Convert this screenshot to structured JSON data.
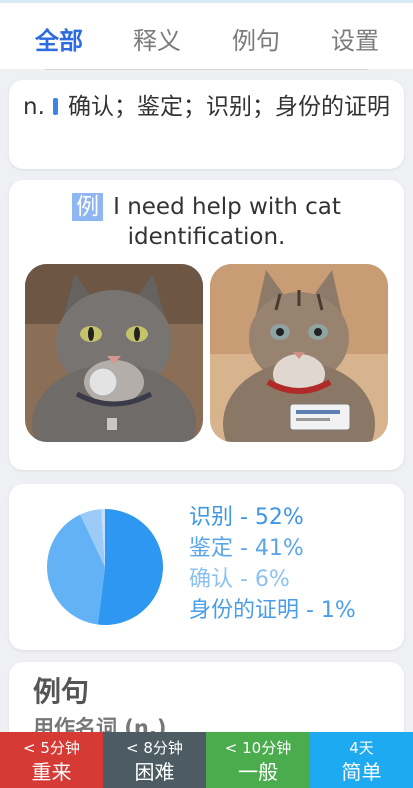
{
  "tabs": [
    {
      "label": "全部",
      "active": true
    },
    {
      "label": "释义",
      "active": false
    },
    {
      "label": "例句",
      "active": false
    },
    {
      "label": "设置",
      "active": false
    }
  ],
  "definition": {
    "pos": "n.",
    "text": "确认；鉴定；识别；身份的证明"
  },
  "example": {
    "badge": "例",
    "sentence": "I need help with cat identification."
  },
  "meaning_stats": {
    "chart_data": {
      "type": "pie",
      "categories": [
        "识别",
        "鉴定",
        "确认",
        "身份的证明"
      ],
      "values": [
        52,
        41,
        6,
        1
      ],
      "colors": [
        "#2e97f2",
        "#64b2f6",
        "#9ccbf8",
        "#c5dffa"
      ]
    },
    "legend": [
      {
        "label": "识别 - 52%",
        "color": "#3d96e6"
      },
      {
        "label": "鉴定 - 41%",
        "color": "#5aa6eb"
      },
      {
        "label": "确认 - 6%",
        "color": "#8cc2f1"
      },
      {
        "label": "身份的证明 - 1%",
        "color": "#4a9ee9"
      }
    ]
  },
  "sentences": {
    "title": "例句",
    "subtitle": "用作名词 (n.)"
  },
  "rating_buttons": [
    {
      "interval": "< 5分钟",
      "label": "重来",
      "color": "#d63a35"
    },
    {
      "interval": "< 8分钟",
      "label": "困难",
      "color": "#4d5b63"
    },
    {
      "interval": "< 10分钟",
      "label": "一般",
      "color": "#4bac4d"
    },
    {
      "interval": "4天",
      "label": "简单",
      "color": "#1eaaf0"
    }
  ]
}
